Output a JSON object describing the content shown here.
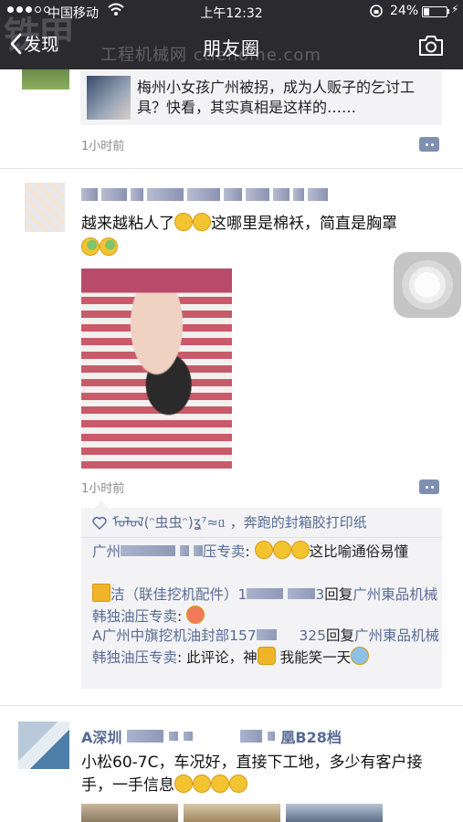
{
  "status_bar": {
    "carrier": "中国移动",
    "time": "上午12:32",
    "battery": "24%",
    "battery_level": 0.24
  },
  "watermark": {
    "text1": "铁甲",
    "text2": "工程机械网",
    "text3": "ctiehome.com"
  },
  "nav": {
    "back_label": "发现",
    "title": "朋友圈"
  },
  "posts": [
    {
      "shared_title": "梅州小女孩广州被拐，成为人贩子的乞讨工具？快看，其实真相是这样的……",
      "time": "1小时前"
    },
    {
      "text": "越来越粘人了",
      "text_tail": "这哪里是棉袄，简直是胸罩",
      "time": "1小时前",
      "likes": "ᠮᠣᠯᠣᠯ(ᵔ虫虫ᵔ)ʓ⁷≈ᥲ ，奔跑的封箱胶打印纸",
      "comments": [
        {
          "name": "广州",
          "name_tail": "压专卖",
          "text": ": ",
          "tail": "这比喻通俗易懂"
        },
        {
          "name": "洁（联佳挖机配件）1",
          "name_tail": "3",
          "text": "回复",
          "reply_to": "广州東品机械韩独油压专卖",
          "tail": ": "
        },
        {
          "name": "A广州中旗挖机油封部157",
          "name_tail": "325",
          "text": "回复",
          "reply_to": "广州東品机械韩独油压专卖",
          "tail": ": 此评论，神",
          "tail2": " 我能笑一天"
        }
      ]
    },
    {
      "name": "A深圳",
      "name_tail": "凰B28档",
      "text": "小松60-7C，车况好，直接下工地，多少有客户接手，一手信息"
    }
  ]
}
